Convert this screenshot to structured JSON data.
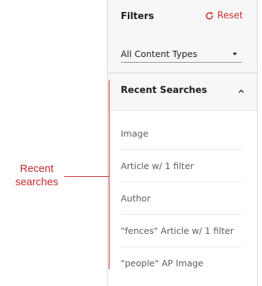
{
  "filters": {
    "title": "Filters",
    "reset_label": "Reset",
    "content_type_selected": "All Content Types"
  },
  "recent_searches": {
    "title": "Recent Searches",
    "items": [
      "Image",
      "Article w/ 1 filter",
      "Author",
      "\"fences\" Article w/ 1 filter",
      "\"people\" AP Image"
    ]
  },
  "annotation": {
    "line1": "Recent",
    "line2": "searches"
  },
  "colors": {
    "accent_red": "#c9302c",
    "annotation_red": "#c4272b",
    "panel_header_bg": "#f7f7f7"
  },
  "icons": {
    "reset": "refresh-icon",
    "dropdown": "caret-down-icon",
    "collapse": "chevron-up-icon"
  }
}
